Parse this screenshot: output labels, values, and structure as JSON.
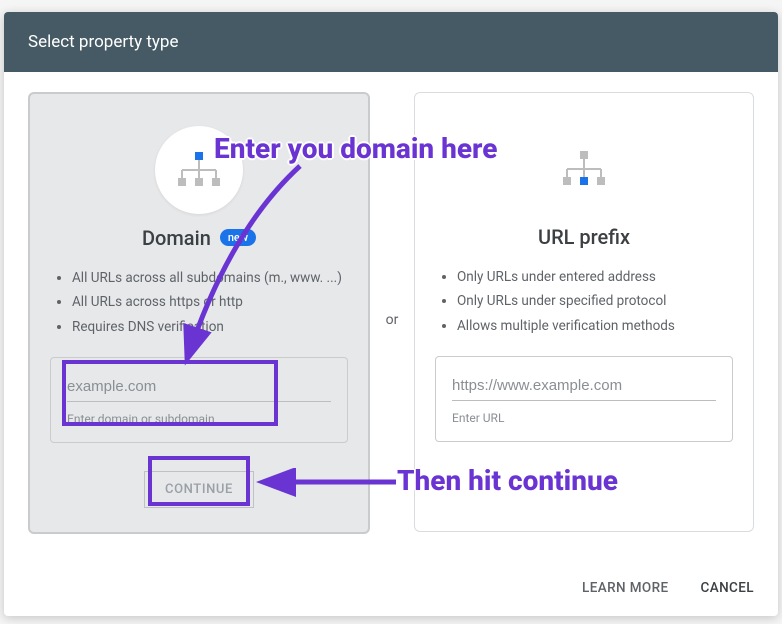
{
  "header": {
    "title": "Select property type"
  },
  "separator": "or",
  "domain_card": {
    "title": "Domain",
    "badge": "new",
    "bullets": [
      "All URLs across all subdomains (m., www. ...)",
      "All URLs across https or http",
      "Requires DNS verification"
    ],
    "input_placeholder": "example.com",
    "input_hint": "Enter domain or subdomain",
    "continue_label": "CONTINUE"
  },
  "url_card": {
    "title": "URL prefix",
    "bullets": [
      "Only URLs under entered address",
      "Only URLs under specified protocol",
      "Allows multiple verification methods"
    ],
    "input_placeholder": "https://www.example.com",
    "input_hint": "Enter URL"
  },
  "footer": {
    "learn_more": "LEARN MORE",
    "cancel": "CANCEL"
  },
  "annotations": {
    "enter_domain": "Enter you domain here",
    "then_continue": "Then hit continue"
  }
}
